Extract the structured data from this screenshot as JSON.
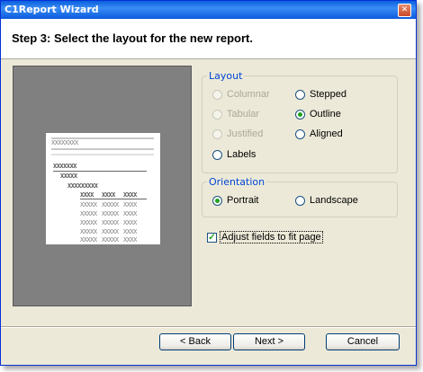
{
  "window": {
    "title": "C1Report Wizard",
    "close_glyph": "✕"
  },
  "header": {
    "step": "Step 3: Select the layout for the new report."
  },
  "preview": {
    "title_text": "XXXXXXXX",
    "group1": "XXXXXXX",
    "group2": "XXXXX",
    "group3": "XXXXXXXXX",
    "columns": [
      "XXXX",
      "XXXX",
      "XXXX"
    ],
    "rows": [
      [
        "XXXXX",
        "XXXXX",
        "XXXX"
      ],
      [
        "XXXXX",
        "XXXXX",
        "XXXX"
      ],
      [
        "XXXXX",
        "XXXXX",
        "XXXX"
      ],
      [
        "XXXXX",
        "XXXXX",
        "XXXX"
      ],
      [
        "XXXXX",
        "XXXXX",
        "XXXX"
      ]
    ]
  },
  "layout": {
    "legend": "Layout",
    "columnar": "Columnar",
    "tabular": "Tabular",
    "justified": "Justified",
    "labels": "Labels",
    "stepped": "Stepped",
    "outline": "Outline",
    "aligned": "Aligned",
    "selected": "outline"
  },
  "orientation": {
    "legend": "Orientation",
    "portrait": "Portrait",
    "landscape": "Landscape",
    "selected": "portrait"
  },
  "adjust": {
    "label": "Adjust fields to fit page",
    "checked": true,
    "check_glyph": "✓"
  },
  "buttons": {
    "back": "< Back",
    "next": "Next >",
    "cancel": "Cancel"
  }
}
